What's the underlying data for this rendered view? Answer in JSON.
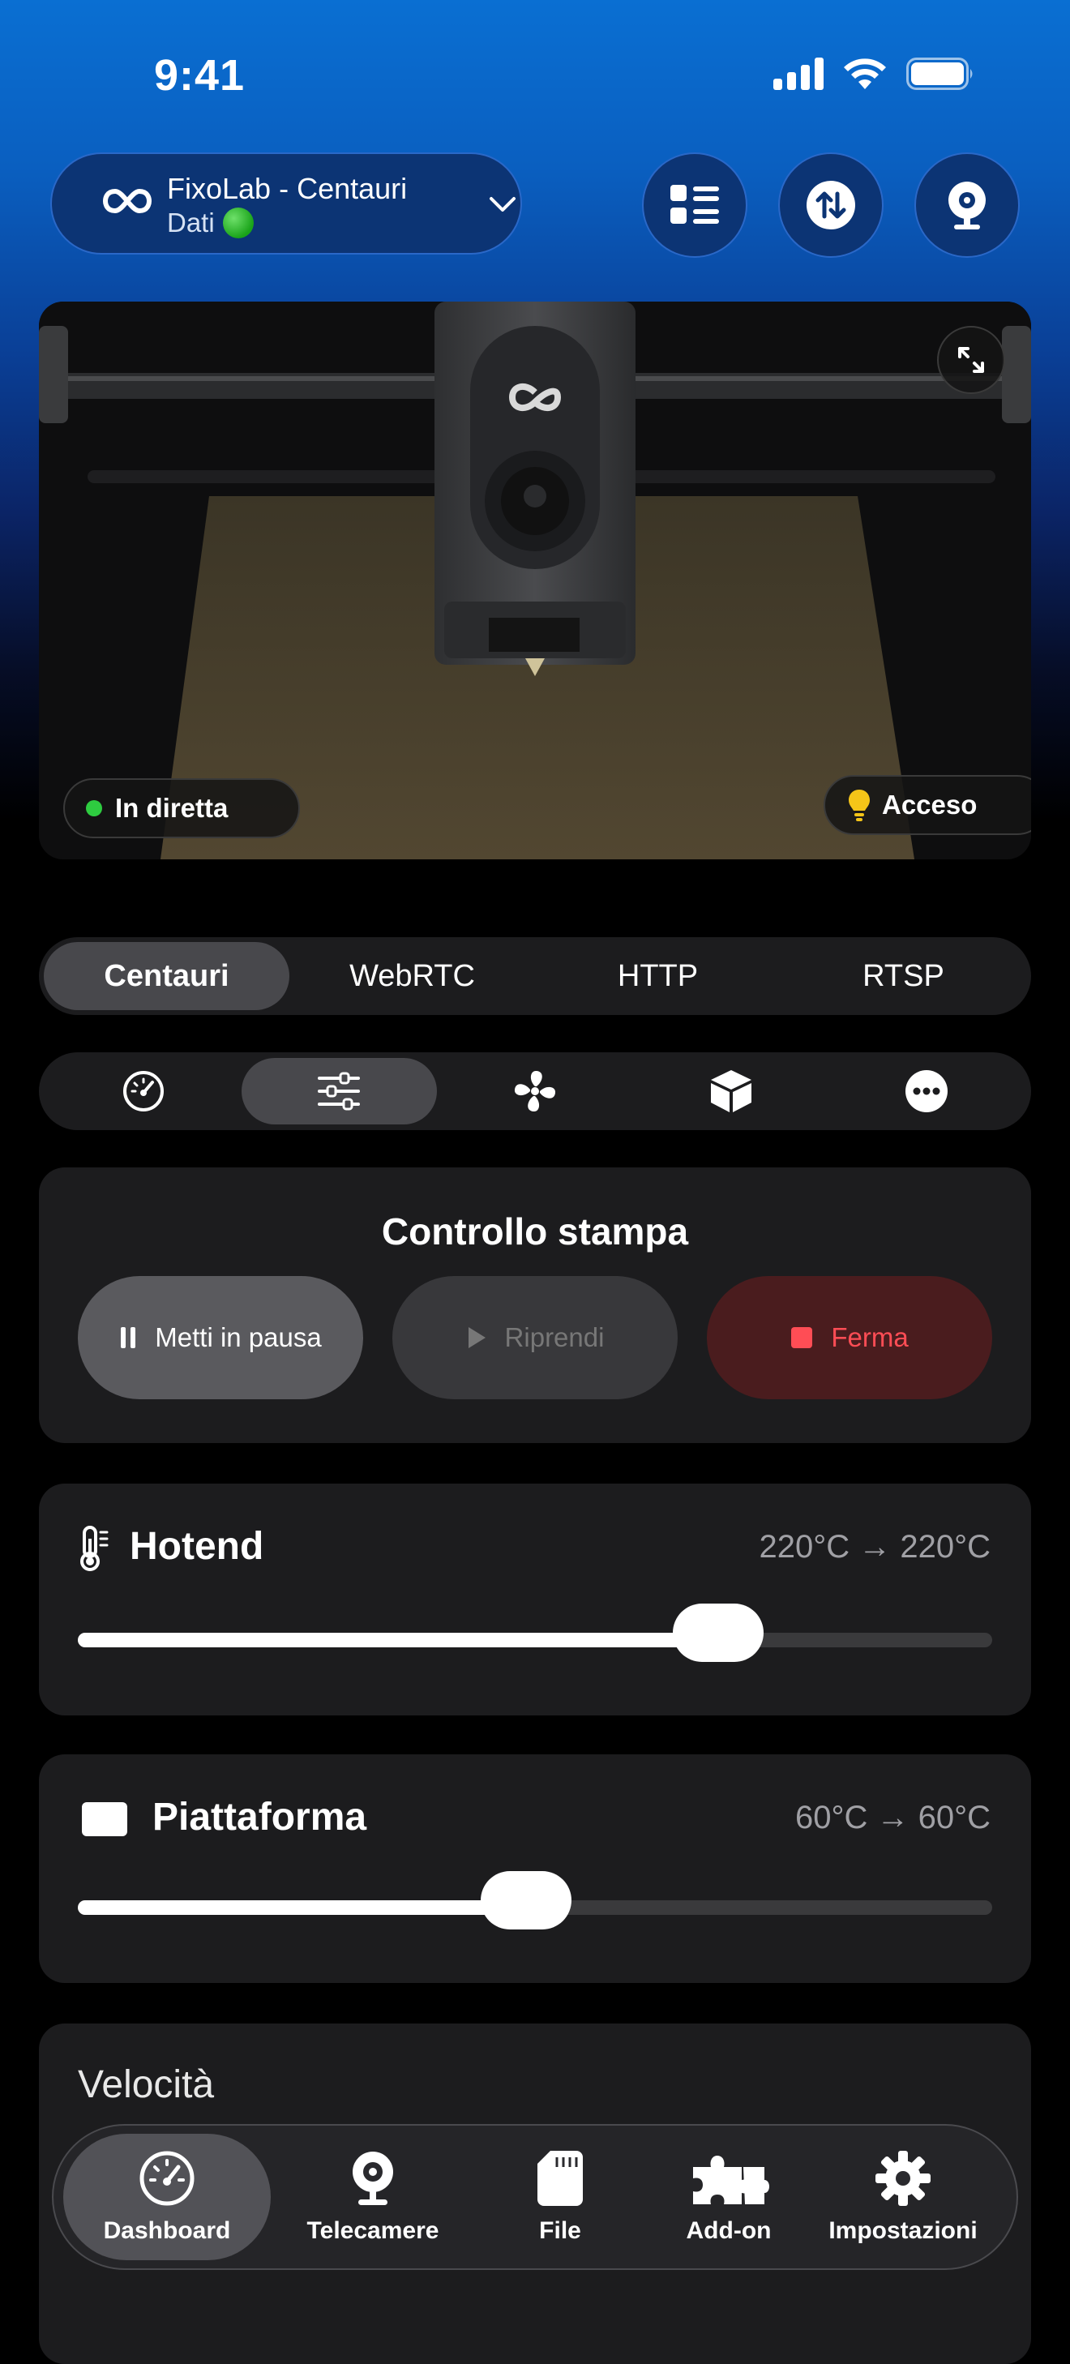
{
  "status_bar": {
    "time": "9:41"
  },
  "printer": {
    "name": "FixoLab - Centauri",
    "connection": "Dati"
  },
  "camera": {
    "live_label": "In diretta",
    "light_label": "Acceso"
  },
  "stream_tabs": [
    {
      "label": "Centauri",
      "active": true
    },
    {
      "label": "WebRTC",
      "active": false
    },
    {
      "label": "HTTP",
      "active": false
    },
    {
      "label": "RTSP",
      "active": false
    }
  ],
  "section_icons": [
    "gauge-icon",
    "sliders-icon",
    "fan-icon",
    "box-icon",
    "more-icon"
  ],
  "print_control": {
    "title": "Controllo stampa",
    "pause_label": "Metti in pausa",
    "resume_label": "Riprendi",
    "stop_label": "Ferma"
  },
  "hotend": {
    "label": "Hotend",
    "value": "220°C → 220°C",
    "level": 0.7
  },
  "bed": {
    "label": "Piattaforma",
    "value": "60°C → 60°C",
    "level": 0.49
  },
  "speed": {
    "label": "Velocità"
  },
  "tabbar": {
    "items": [
      {
        "label": "Dashboard",
        "icon": "gauge-icon",
        "active": true
      },
      {
        "label": "Telecamere",
        "icon": "webcam-icon",
        "active": false
      },
      {
        "label": "File",
        "icon": "sd-card-icon",
        "active": false
      },
      {
        "label": "Add-on",
        "icon": "puzzle-icon",
        "active": false
      },
      {
        "label": "Impostazioni",
        "icon": "gear-icon",
        "active": false
      }
    ]
  },
  "colors": {
    "accent": "#0a6fd2",
    "stop": "#ff4d55",
    "live": "#2ecc40",
    "bulb": "#f5c518"
  }
}
